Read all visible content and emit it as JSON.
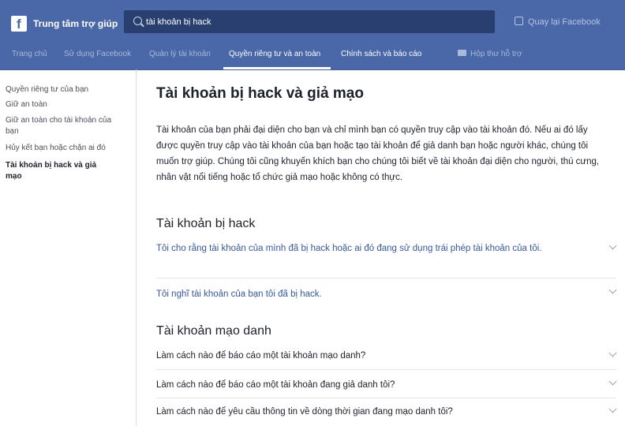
{
  "header": {
    "brand": "Trung tâm trợ giúp",
    "search_value": "tài khoản bị hack",
    "back_link": "Quay lại Facebook",
    "logo_letter": "f"
  },
  "nav": {
    "items": [
      "Trang chủ",
      "Sử dụng Facebook",
      "Quản lý tài khoản",
      "Quyền riêng tư và an toàn",
      "Chính sách và báo cáo",
      "Hộp thư hỗ trợ"
    ],
    "active": "Quyền riêng tư và an toàn"
  },
  "sidebar": {
    "items": [
      "Quyền riêng tư của bạn",
      "Giữ an toàn",
      "Giữ an toàn cho tài khoản của bạn",
      "Hủy kết bạn hoặc chặn ai đó",
      "Tài khoản bị hack và giả mạo"
    ]
  },
  "main": {
    "title": "Tài khoản bị hack và giả mạo",
    "intro": "Tài khoản của bạn phải đại diện cho bạn và chỉ mình bạn có quyền truy cập vào tài khoản đó. Nếu ai đó lấy được quyền truy cập vào tài khoản của bạn hoặc tạo tài khoản để giả danh bạn hoặc người khác, chúng tôi muốn trợ giúp. Chúng tôi cũng khuyến khích bạn cho chúng tôi biết về tài khoản đại diện cho người, thú cưng, nhân vật nổi tiếng hoặc tổ chức giả mạo hoặc không có thực.",
    "section_hacked": "Tài khoản bị hack",
    "hacked_q1": "Tôi cho rằng tài khoản của mình đã bị hack hoặc ai đó đang sử dụng trái phép tài khoản của tôi.",
    "hacked_q2": "Tôi nghĩ tài khoản của bạn tôi đã bị hack.",
    "section_fake": "Tài khoản mạo danh",
    "fake_q1": "Làm cách nào để báo cáo một tài khoản mạo danh?",
    "fake_q2": "Làm cách nào để báo cáo một tài khoản đang giả danh tôi?",
    "fake_q3": "Làm cách nào để yêu cầu thông tin về dòng thời gian đang mạo danh tôi?"
  },
  "colors": {
    "header_bg": "#4a67a8",
    "search_bg": "#293f6f",
    "link": "#365899"
  }
}
